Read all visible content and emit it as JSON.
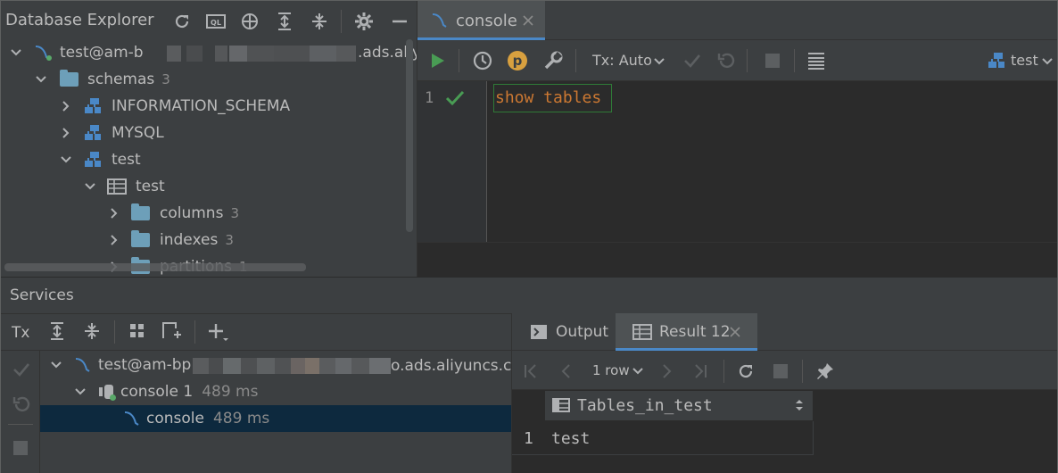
{
  "db_explorer": {
    "title": "Database Explorer",
    "connection": {
      "label_prefix": "test@am-b",
      "label_suffix": ".ads.aliy"
    },
    "tree": [
      {
        "label": "schemas",
        "count": "3"
      },
      {
        "label": "INFORMATION_SCHEMA"
      },
      {
        "label": "MYSQL"
      },
      {
        "label": "test"
      },
      {
        "label": "test"
      },
      {
        "label": "columns",
        "count": "3"
      },
      {
        "label": "indexes",
        "count": "3"
      },
      {
        "label": "partitions",
        "count": "1"
      }
    ]
  },
  "editor": {
    "tab_label": "console",
    "toolbar": {
      "tx_label": "Tx: Auto",
      "p_label": "p",
      "schema_label": "test"
    },
    "line_number": "1",
    "code": "show tables"
  },
  "services": {
    "title": "Services",
    "tx_label": "Tx",
    "tree": {
      "connection_prefix": "test@am-bp",
      "connection_suffix": "o.ads.aliyuncs.co",
      "console1_label": "console 1",
      "console1_time": "489 ms",
      "console_label": "console",
      "console_time": "489 ms"
    },
    "tabs": {
      "output": "Output",
      "result": "Result 12"
    },
    "result_toolbar": {
      "rows": "1 row"
    },
    "table": {
      "column": "Tables_in_test",
      "rows": [
        {
          "num": "1",
          "value": "test"
        }
      ]
    }
  },
  "colors": {
    "accent": "#4a88c7",
    "keyword": "#cc7832",
    "selection": "#0d293e",
    "green": "#499c54"
  }
}
